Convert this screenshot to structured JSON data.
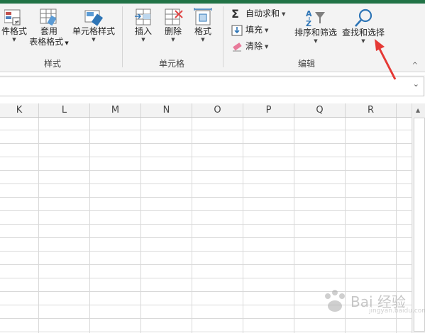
{
  "ribbon": {
    "styles_group": {
      "conditional_format_label": "件格式",
      "format_as_table_line1": "套用",
      "format_as_table_line2": "表格格式",
      "cell_styles_label": "单元格样式",
      "group_label": "样式"
    },
    "cells_group": {
      "insert_label": "插入",
      "delete_label": "删除",
      "format_label": "格式",
      "group_label": "单元格"
    },
    "editing_group": {
      "autosum_label": "自动求和",
      "fill_label": "填充",
      "clear_label": "清除",
      "sort_filter_label": "排序和筛选",
      "find_select_label": "查找和选择",
      "group_label": "编辑"
    },
    "collapse_glyph": "^"
  },
  "formula_bar": {
    "value": "",
    "expand_glyph": "⌄"
  },
  "columns": [
    "K",
    "L",
    "M",
    "N",
    "O",
    "P",
    "Q",
    "R"
  ],
  "colors": {
    "title_bar": "#217346",
    "ribbon_bg": "#f3f3f3",
    "annotation_arrow": "#e53935"
  },
  "watermark": {
    "brand": "Bai 经验",
    "sub": "jingyan.baidu.com"
  }
}
